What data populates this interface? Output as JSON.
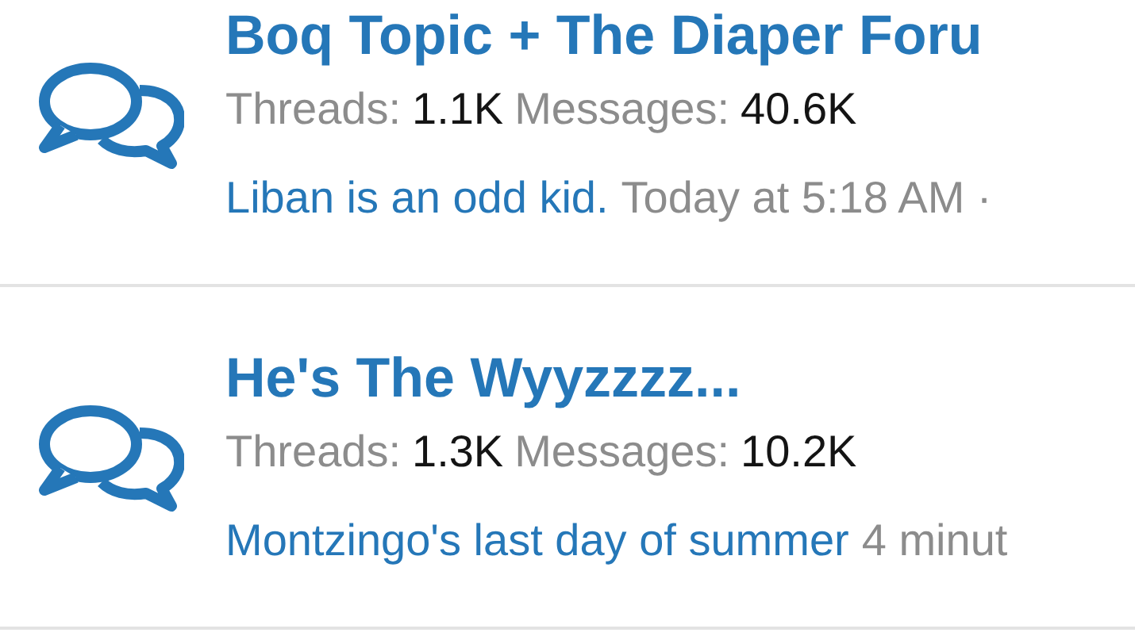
{
  "forums": [
    {
      "title": "Boq Topic + The Diaper Foru",
      "threads_label": "Threads:",
      "threads": "1.1K",
      "messages_label": "Messages:",
      "messages": "40.6K",
      "last_post": "Liban is an odd kid.",
      "last_time": "Today at 5:18 AM ·"
    },
    {
      "title": "He's The Wyyzzzz...",
      "threads_label": "Threads:",
      "threads": "1.3K",
      "messages_label": "Messages:",
      "messages": "10.2K",
      "last_post": "Montzingo's last day of summer",
      "last_time": "4 minut"
    }
  ]
}
